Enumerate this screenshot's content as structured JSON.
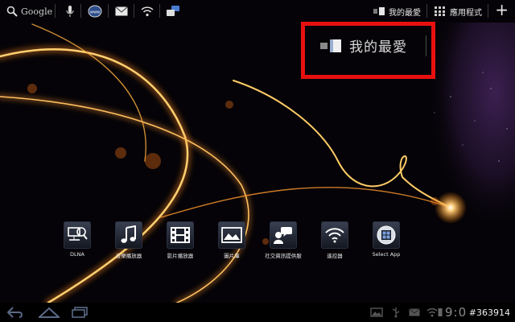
{
  "search": {
    "label": "Google",
    "icon": "search-icon"
  },
  "top_icons": [
    "mic-icon",
    "www-icon",
    "mail-icon",
    "wifi-icon",
    "social-icon"
  ],
  "top_right": {
    "favorites_label": "我的最愛",
    "apps_label": "應用程式",
    "add_icon": "plus-icon"
  },
  "favorites_title": "我的最愛",
  "apps": [
    {
      "label": "DLNA",
      "icon": "dlna-icon"
    },
    {
      "label": "音樂播放器",
      "icon": "music-note-icon"
    },
    {
      "label": "影片播放器",
      "icon": "film-icon"
    },
    {
      "label": "圖片庫",
      "icon": "picture-icon"
    },
    {
      "label": "社交資訊提供服",
      "icon": "social-feed-icon"
    },
    {
      "label": "遙控器",
      "icon": "wifi-remote-icon"
    },
    {
      "label": "Select App",
      "icon": "select-app-icon"
    }
  ],
  "system_bar": {
    "nav": [
      "back-icon",
      "home-icon",
      "recent-apps-icon"
    ],
    "status_icons": [
      "gallery-icon",
      "usb-icon",
      "mail-icon",
      "wifi-icon",
      "battery-icon"
    ],
    "clock": "9:0",
    "watermark": "#363914"
  },
  "colors": {
    "highlight": "#e8100f",
    "glow": "#ffb347"
  }
}
